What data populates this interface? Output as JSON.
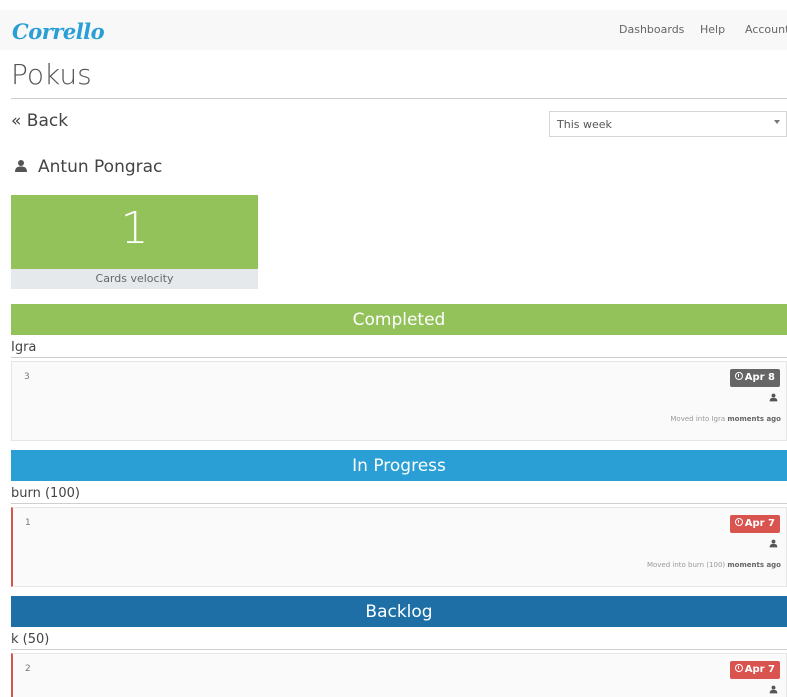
{
  "app": {
    "brand": "Corrello",
    "nav": [
      "Dashboards",
      "Help",
      "Account"
    ]
  },
  "page": {
    "title": "Pokus",
    "back_label": "« Back",
    "period_value": "This week"
  },
  "user": {
    "name": "Antun Pongrac",
    "icon": "user-icon"
  },
  "velocity": {
    "value": "1",
    "label": "Cards velocity"
  },
  "sections": [
    {
      "title": "Completed",
      "color": "#93c15a",
      "list": "Igra",
      "card": {
        "number": "3",
        "due": "Apr 8",
        "due_color": "#666666",
        "moved_prefix": "Moved into Igra",
        "moved_when": "moments ago"
      }
    },
    {
      "title": "In Progress",
      "color": "#2a9fd6",
      "list": "burn (100)",
      "card": {
        "number": "1",
        "due": "Apr 7",
        "due_color": "#d9534f",
        "moved_prefix": "Moved into burn (100)",
        "moved_when": "moments ago"
      }
    },
    {
      "title": "Backlog",
      "color": "#1d6fa5",
      "list": "k (50)",
      "card": {
        "number": "2",
        "due": "Apr 7",
        "due_color": "#d9534f"
      }
    }
  ]
}
